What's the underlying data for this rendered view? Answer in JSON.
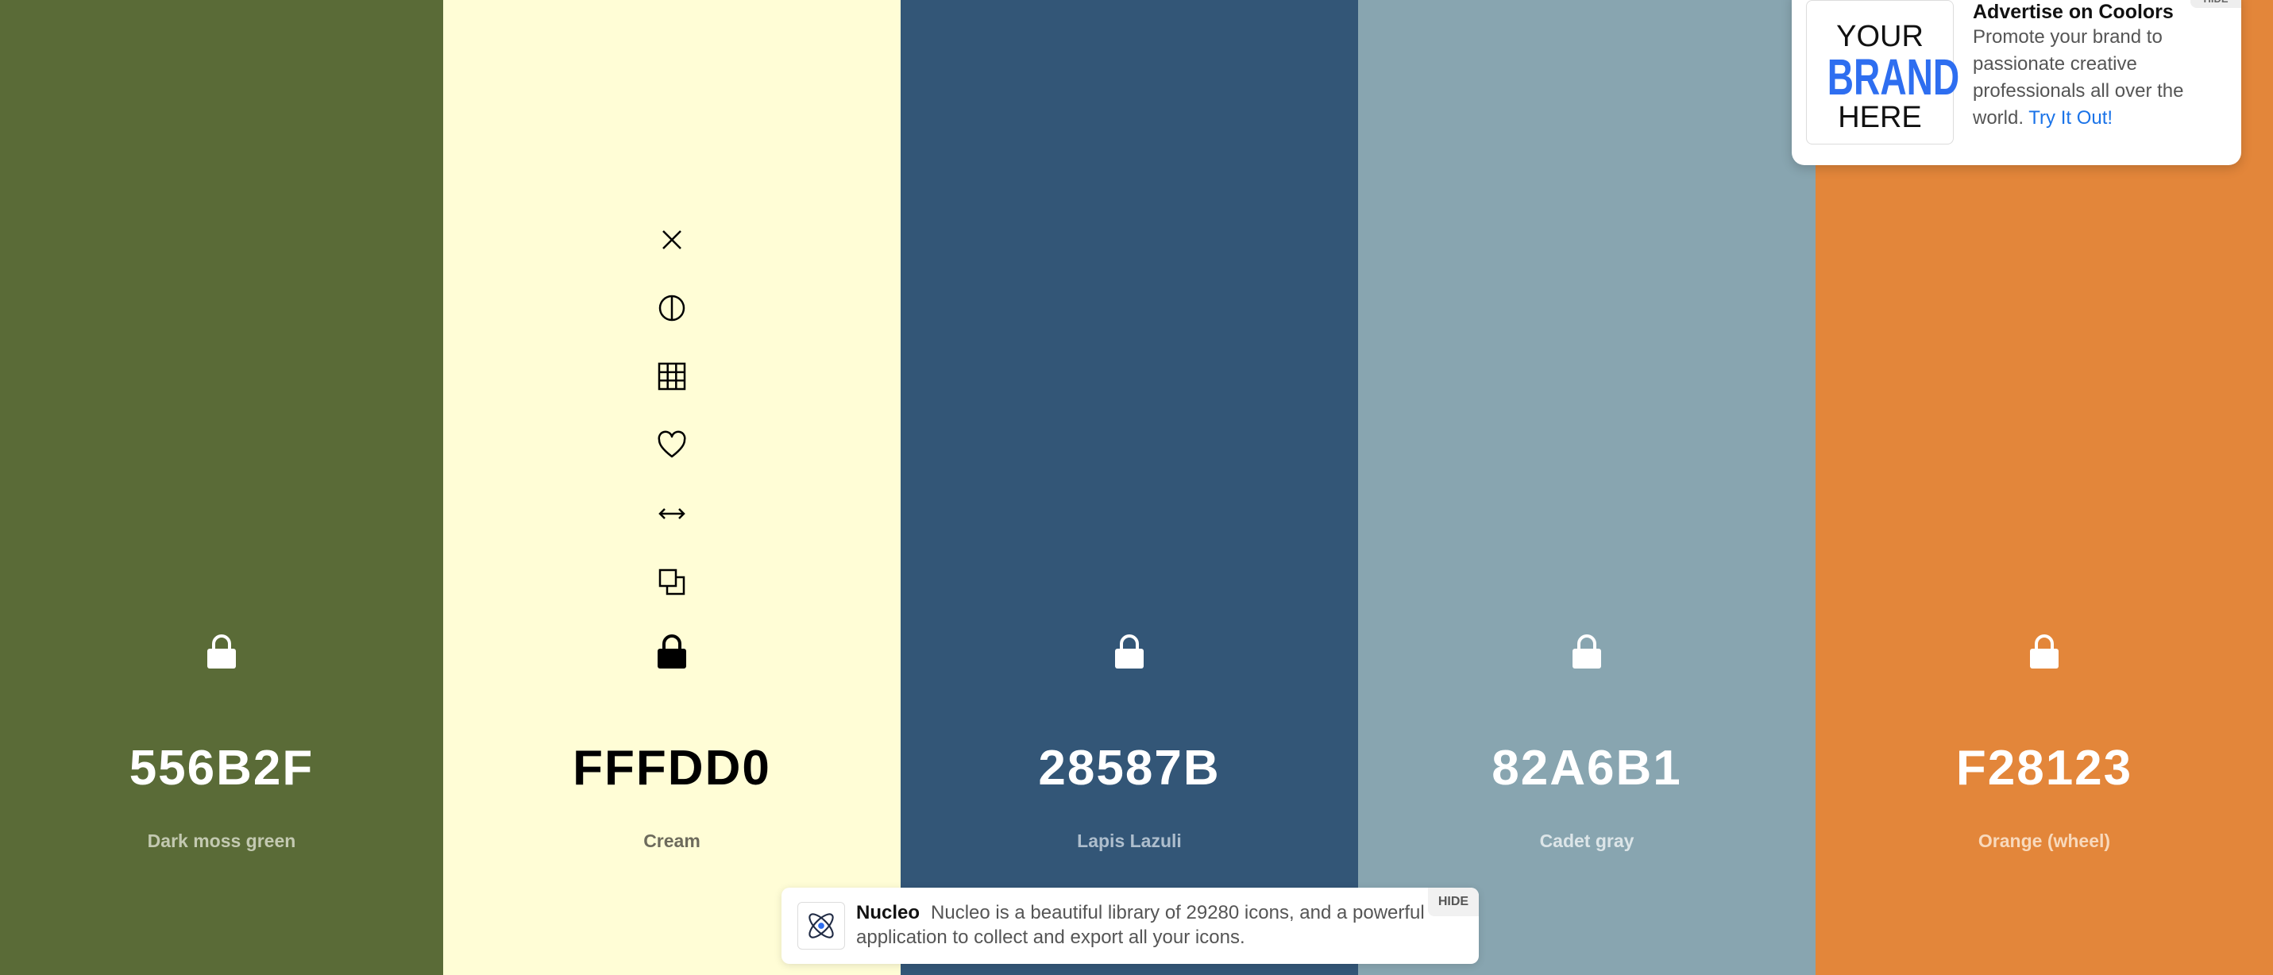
{
  "swatches": [
    {
      "hex": "556B2F",
      "name": "Dark moss green",
      "bg": "#5A6B37",
      "hex_color": "#FFFFFF",
      "name_color": "#C3C9B1",
      "lock_color": "#FFFFFF"
    },
    {
      "hex": "FFFDD0",
      "name": "Cream",
      "bg": "#FFFDD6",
      "hex_color": "#000000",
      "name_color": "#6D6B5C",
      "lock_color": "#000000"
    },
    {
      "hex": "28587B",
      "name": "Lapis Lazuli",
      "bg": "#335677",
      "hex_color": "#FFFFFF",
      "name_color": "#AEBECD",
      "lock_color": "#FFFFFF"
    },
    {
      "hex": "82A6B1",
      "name": "Cadet gray",
      "bg": "#88A5B0",
      "hex_color": "#FFFFFF",
      "name_color": "#DCE5E8",
      "lock_color": "#FFFFFF"
    },
    {
      "hex": "F28123",
      "name": "Orange (wheel)",
      "bg": "#E3863A",
      "hex_color": "#FFFFFF",
      "name_color": "#F8D9BC",
      "lock_color": "#FFFFFF"
    }
  ],
  "column_tools": [
    "close-icon",
    "contrast-icon",
    "grid-icon",
    "heart-icon",
    "drag-icon",
    "copy-icon"
  ],
  "ad": {
    "logo_line1": "YOUR",
    "logo_line2": "BRAND",
    "logo_line3": "HERE",
    "title": "Advertise on Coolors",
    "body": "Promote your brand to passionate creative professionals all over the world.",
    "link": "Try It Out!",
    "hide": "HIDE"
  },
  "banner": {
    "brand": "Nucleo",
    "text": "Nucleo is a beautiful library of 29280 icons, and a powerful application to collect and export all your icons.",
    "hide": "HIDE"
  }
}
